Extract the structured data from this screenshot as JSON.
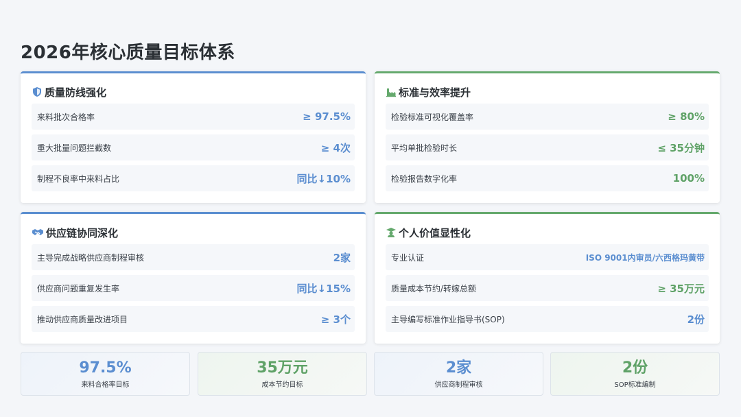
{
  "page_title": "2026年核心质量目标体系",
  "cards": [
    {
      "title": "质量防线强化",
      "icon": "shield-icon",
      "accent": "#5b8ed0",
      "rows": [
        {
          "label": "来料批次合格率",
          "value": "≥ 97.5%"
        },
        {
          "label": "重大批量问题拦截数",
          "value": "≥ 4次"
        },
        {
          "label": "制程不良率中来料占比",
          "value": "同比↓10%"
        }
      ]
    },
    {
      "title": "标准与效率提升",
      "icon": "factory-icon",
      "accent": "#65a96d",
      "rows": [
        {
          "label": "检验标准可视化覆盖率",
          "value": "≥ 80%"
        },
        {
          "label": "平均单批检验时长",
          "value": "≤ 35分钟"
        },
        {
          "label": "检验报告数字化率",
          "value": "100%"
        }
      ]
    },
    {
      "title": "供应链协同深化",
      "icon": "handshake-icon",
      "accent": "#5b8ed0",
      "rows": [
        {
          "label": "主导完成战略供应商制程审核",
          "value": "2家"
        },
        {
          "label": "供应商问题重复发生率",
          "value": "同比↓15%"
        },
        {
          "label": "推动供应商质量改进项目",
          "value": "≥ 3个"
        }
      ]
    },
    {
      "title": "个人价值显性化",
      "icon": "graduate-icon",
      "accent": "#65a96d",
      "rows": [
        {
          "label": "专业认证",
          "value": "ISO 9001内审员/六西格玛黄带"
        },
        {
          "label": "质量成本节约/转嫁总额",
          "value": "≥ 35万元"
        },
        {
          "label": "主导编写标准作业指导书(SOP)",
          "value": "2份"
        }
      ]
    }
  ],
  "stats": [
    {
      "value": "97.5%",
      "caption": "来料合格率目标"
    },
    {
      "value": "35万元",
      "caption": "成本节约目标"
    },
    {
      "value": "2家",
      "caption": "供应商制程审核"
    },
    {
      "value": "2份",
      "caption": "SOP标准编制"
    }
  ]
}
